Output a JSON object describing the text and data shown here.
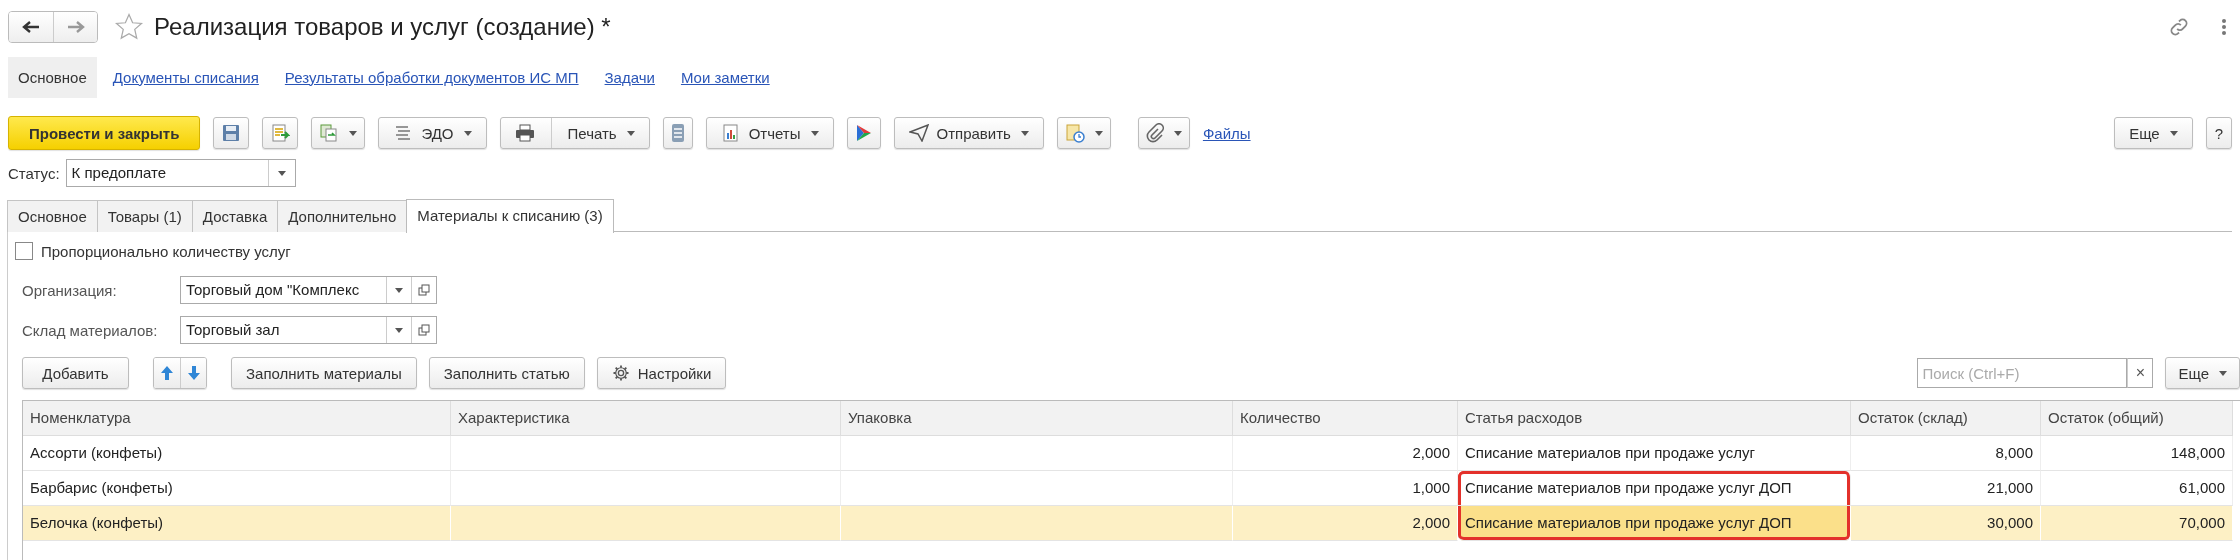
{
  "window": {
    "title": "Реализация товаров и услуг (создание) *"
  },
  "nav": [
    {
      "label": "Основное",
      "selected": true
    },
    {
      "label": "Документы списания",
      "selected": false
    },
    {
      "label": "Результаты обработки документов ИС МП",
      "selected": false
    },
    {
      "label": "Задачи",
      "selected": false
    },
    {
      "label": "Мои заметки",
      "selected": false
    }
  ],
  "toolbar": {
    "post_button": "Провести и закрыть",
    "edo": "ЭДО",
    "print": "Печать",
    "reports": "Отчеты",
    "send": "Отправить",
    "files_link": "Файлы",
    "more": "Еще",
    "help": "?"
  },
  "status": {
    "label": "Статус:",
    "value": "К предоплате"
  },
  "tabs": [
    {
      "label": "Основное",
      "selected": false
    },
    {
      "label": "Товары (1)",
      "selected": false
    },
    {
      "label": "Доставка",
      "selected": false
    },
    {
      "label": "Дополнительно",
      "selected": false
    },
    {
      "label": "Материалы к списанию (3)",
      "selected": true
    }
  ],
  "proportional": {
    "label": "Пропорционально количеству услуг",
    "checked": false
  },
  "fields": [
    {
      "label": "Организация:",
      "value": "Торговый дом \"Комплекс"
    },
    {
      "label": "Склад материалов:",
      "value": "Торговый зал"
    }
  ],
  "table_toolbar": {
    "add": "Добавить",
    "fill_materials": "Заполнить материалы",
    "fill_article": "Заполнить статью",
    "settings": "Настройки",
    "search_placeholder": "Поиск (Ctrl+F)",
    "clear": "×",
    "more": "Еще"
  },
  "table": {
    "columns": [
      {
        "label": "Номенклатура",
        "current": false
      },
      {
        "label": "Характеристика",
        "current": false
      },
      {
        "label": "Упаковка",
        "current": false
      },
      {
        "label": "Количество",
        "current": false
      },
      {
        "label": "Статья расходов",
        "current": true
      },
      {
        "label": "Остаток (склад)",
        "current": false
      },
      {
        "label": "Остаток (общий)",
        "current": false
      }
    ],
    "rows": [
      {
        "cells": [
          "Ассорти (конфеты)",
          "",
          "",
          "2,000",
          "Списание материалов при продаже услуг",
          "8,000",
          "148,000"
        ],
        "selected": false,
        "marked": false
      },
      {
        "cells": [
          "Барбарис (конфеты)",
          "",
          "",
          "1,000",
          "Списание материалов при продаже услуг ДОП",
          "21,000",
          "61,000"
        ],
        "selected": false,
        "marked": true
      },
      {
        "cells": [
          "Белочка (конфеты)",
          "",
          "",
          "2,000",
          "Списание материалов при продаже услуг ДОП",
          "30,000",
          "70,000"
        ],
        "selected": true,
        "marked": true
      }
    ]
  }
}
